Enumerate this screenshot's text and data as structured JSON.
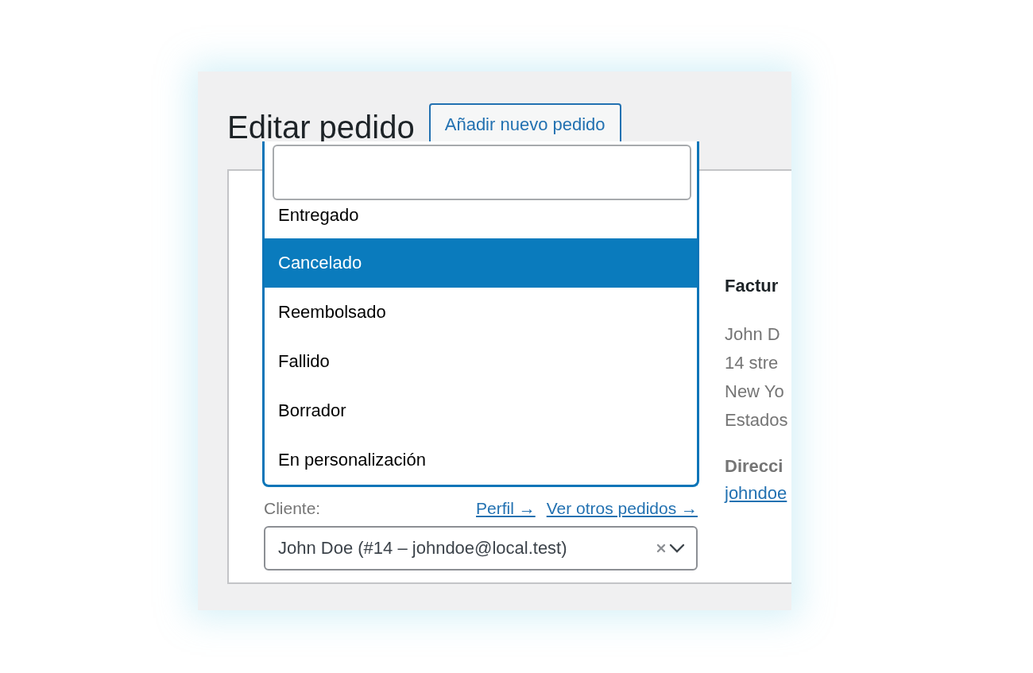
{
  "page_title": "Editar pedido",
  "add_button": "Añadir nuevo pedido",
  "status_dropdown": {
    "options": [
      {
        "label": "Entregado",
        "selected": false
      },
      {
        "label": "Cancelado",
        "selected": true
      },
      {
        "label": "Reembolsado",
        "selected": false
      },
      {
        "label": "Fallido",
        "selected": false
      },
      {
        "label": "Borrador",
        "selected": false
      },
      {
        "label": "En personalización",
        "selected": false
      }
    ]
  },
  "customer": {
    "label": "Cliente:",
    "links": [
      "Perfil →",
      "Ver otros pedidos →"
    ],
    "value": "John Doe (#14 – johndoe@local.test)"
  },
  "billing": {
    "heading": "Factur",
    "address": [
      "John D",
      "14 stre",
      "New Yo",
      "Estados"
    ],
    "email_label": "Direcci",
    "email": "johndoe"
  }
}
